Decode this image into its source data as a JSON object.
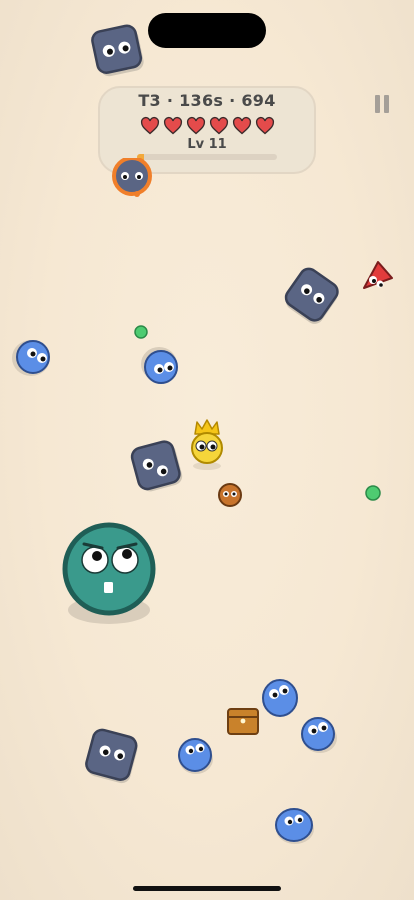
{
  "hud": {
    "stats": "T3 · 136s · 694",
    "hearts": 6,
    "level_label": "Lv 11",
    "xp_fraction": 0.05
  },
  "colors": {
    "heart": "#e44b4b",
    "xp": "#f2a93b",
    "teal_boss": "#3a9a8c",
    "blue_blob": "#5b8ee6",
    "grey_block": "#5a6584",
    "gem": "#4ecb71",
    "chest": "#c9822b"
  },
  "icons": [
    "pause-icon",
    "heart-icon",
    "crown-icon",
    "treasure-chest-icon",
    "xp-gem-icon"
  ]
}
